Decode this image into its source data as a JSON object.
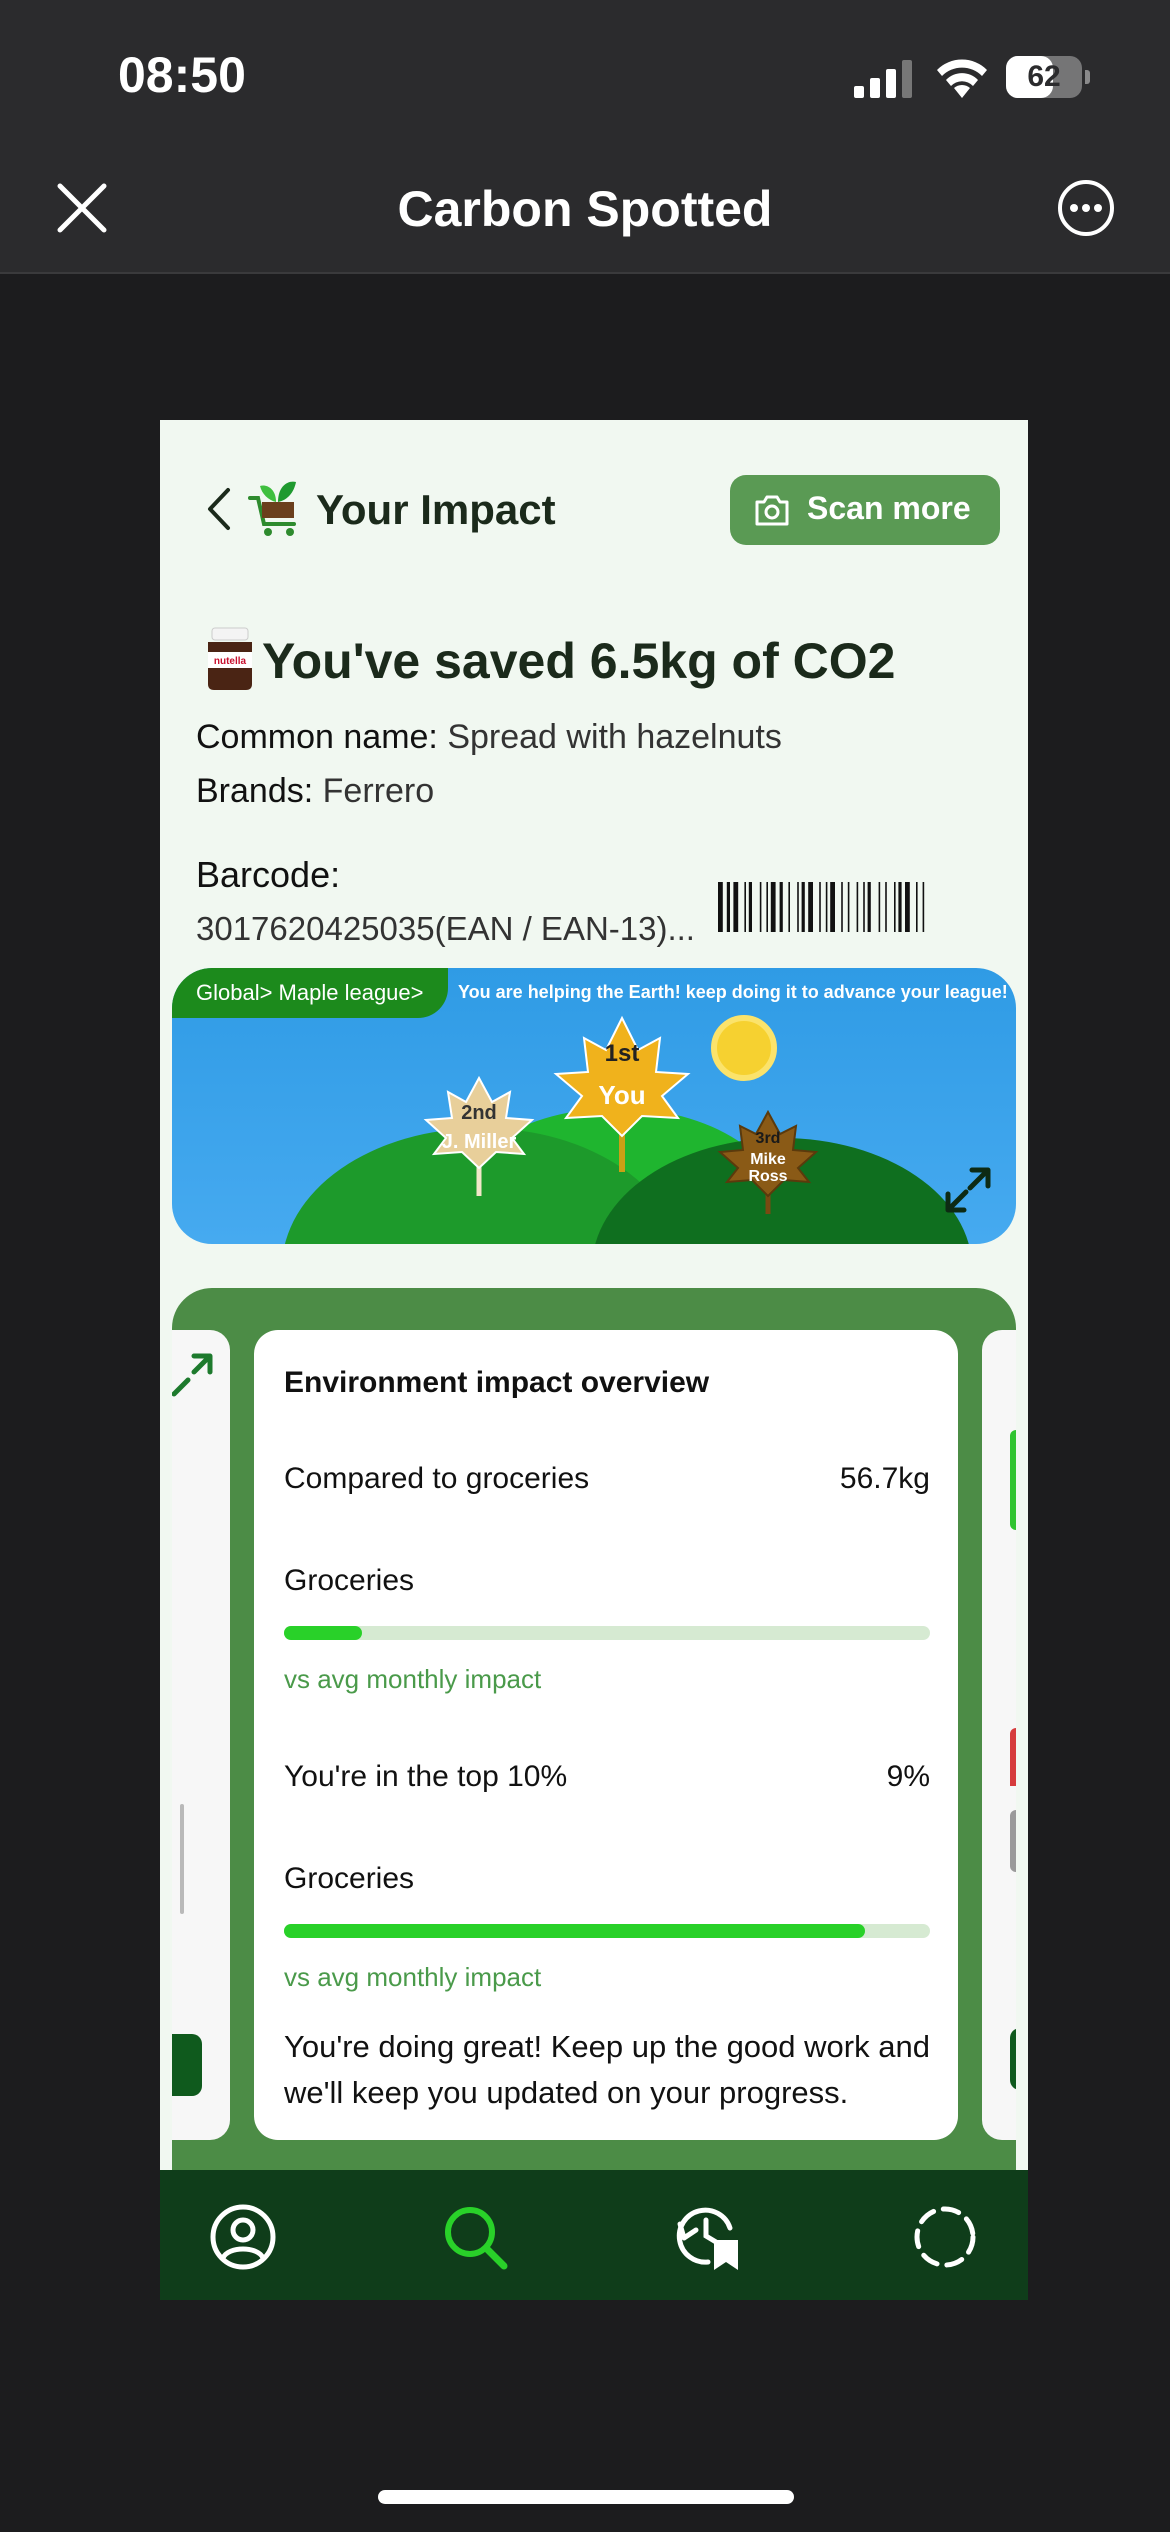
{
  "status": {
    "time": "08:50",
    "battery": "62",
    "battery_level": 0.62
  },
  "nav": {
    "title": "Carbon Spotted"
  },
  "header": {
    "title": "Your Impact",
    "scan_button": "Scan more"
  },
  "product": {
    "headline": "You've saved 6.5kg of CO2",
    "common_name_label": "Common name:",
    "common_name": "Spread with hazelnuts",
    "brands_label": "Brands:",
    "brands": "Ferrero",
    "barcode_label": "Barcode:",
    "barcode": "3017620425035(EAN / EAN-13)..."
  },
  "league": {
    "breadcrumb": "Global> Maple league>",
    "message": "You are helping the Earth! keep doing it to advance your league!",
    "first": {
      "rank": "1st",
      "name": "You"
    },
    "second": {
      "rank": "2nd",
      "name": "J. Miller"
    },
    "third": {
      "rank": "3rd",
      "name_line1": "Mike",
      "name_line2": "Ross"
    }
  },
  "overview": {
    "title": "Environment impact overview",
    "compared_label": "Compared to groceries",
    "compared_value": "56.7kg",
    "groceries_1": "Groceries",
    "progress_1": 0.12,
    "sub_1": "vs avg monthly impact",
    "top_label": "You're in the top 10%",
    "top_value": "9%",
    "groceries_2": "Groceries",
    "progress_2": 0.9,
    "sub_2": "vs avg monthly impact",
    "message": "You're doing great! Keep up the good work and we'll keep you updated on your progress."
  },
  "tabs": [
    {
      "icon": "profile-icon",
      "active": false
    },
    {
      "icon": "search-icon",
      "active": true
    },
    {
      "icon": "history-bookmark-icon",
      "active": false
    },
    {
      "icon": "loading-circle-icon",
      "active": false
    }
  ],
  "colors": {
    "brand": "#5a9a54",
    "accent": "#29d129",
    "tabbar": "#0f3d1a"
  }
}
